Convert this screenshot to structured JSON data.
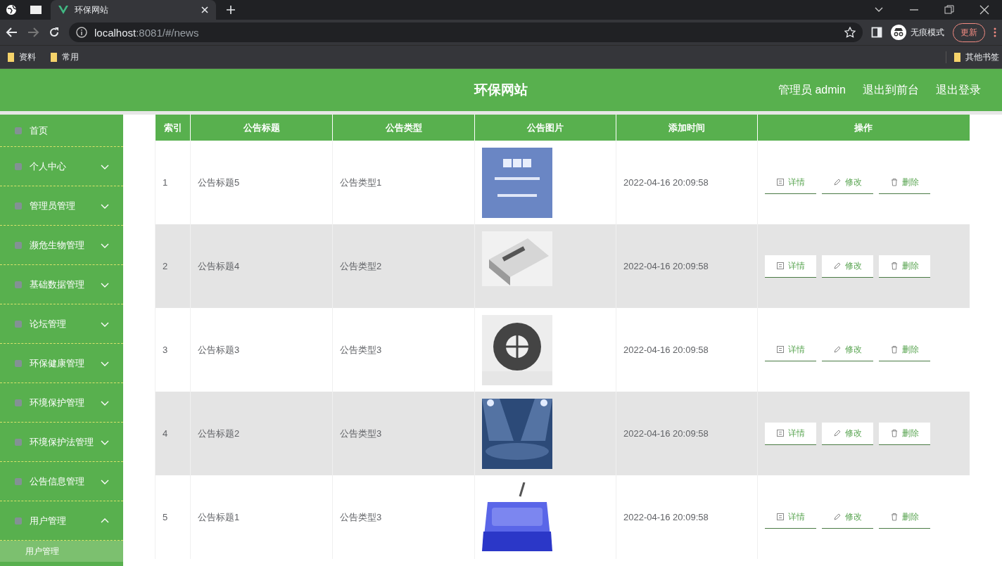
{
  "browser": {
    "tab_title": "环保网站",
    "url_host": "localhost",
    "url_path": ":8081/#/news",
    "incognito_label": "无痕模式",
    "update_button": "更新",
    "bookmarks": [
      "资料",
      "常用"
    ],
    "other_bookmarks": "其他书签"
  },
  "header": {
    "title": "环保网站",
    "links": [
      "管理员 admin",
      "退出到前台",
      "退出登录"
    ]
  },
  "sidebar": {
    "items": [
      {
        "label": "首页",
        "kind": "link"
      },
      {
        "label": "个人中心",
        "kind": "menu",
        "expanded": false
      },
      {
        "label": "管理员管理",
        "kind": "menu",
        "expanded": false
      },
      {
        "label": "濒危生物管理",
        "kind": "menu",
        "expanded": false
      },
      {
        "label": "基础数据管理",
        "kind": "menu",
        "expanded": false
      },
      {
        "label": "论坛管理",
        "kind": "menu",
        "expanded": false
      },
      {
        "label": "环保健康管理",
        "kind": "menu",
        "expanded": false
      },
      {
        "label": "环境保护管理",
        "kind": "menu",
        "expanded": false
      },
      {
        "label": "环境保护法管理",
        "kind": "menu",
        "expanded": false
      },
      {
        "label": "公告信息管理",
        "kind": "menu",
        "expanded": false
      },
      {
        "label": "用户管理",
        "kind": "menu",
        "expanded": true,
        "children": [
          {
            "label": "用户管理"
          }
        ]
      }
    ]
  },
  "table": {
    "columns": [
      "索引",
      "公告标题",
      "公告类型",
      "公告图片",
      "添加时间",
      "操作"
    ],
    "rows": [
      {
        "index": "1",
        "title": "公告标题5",
        "type": "公告类型1",
        "time": "2022-04-16 20:09:58",
        "actions": [
          {
            "label": "详情",
            "kind": "detail"
          },
          {
            "label": "修改",
            "kind": "edit"
          },
          {
            "label": "删除",
            "kind": "delete"
          }
        ]
      },
      {
        "index": "2",
        "title": "公告标题4",
        "type": "公告类型2",
        "time": "2022-04-16 20:09:58",
        "actions": [
          {
            "label": "详情",
            "kind": "detail"
          },
          {
            "label": "修改",
            "kind": "edit"
          },
          {
            "label": "删除",
            "kind": "delete"
          }
        ]
      },
      {
        "index": "3",
        "title": "公告标题3",
        "type": "公告类型3",
        "time": "2022-04-16 20:09:58",
        "actions": [
          {
            "label": "详情",
            "kind": "detail"
          },
          {
            "label": "修改",
            "kind": "edit"
          },
          {
            "label": "删除",
            "kind": "delete"
          }
        ]
      },
      {
        "index": "4",
        "title": "公告标题2",
        "type": "公告类型3",
        "time": "2022-04-16 20:09:58",
        "actions": [
          {
            "label": "详情",
            "kind": "detail"
          },
          {
            "label": "修改",
            "kind": "edit"
          },
          {
            "label": "删除",
            "kind": "delete"
          }
        ]
      },
      {
        "index": "5",
        "title": "公告标题1",
        "type": "公告类型3",
        "time": "2022-04-16 20:09:58",
        "actions": [
          {
            "label": "详情",
            "kind": "detail"
          },
          {
            "label": "修改",
            "kind": "edit"
          },
          {
            "label": "删除",
            "kind": "delete"
          }
        ]
      }
    ]
  }
}
